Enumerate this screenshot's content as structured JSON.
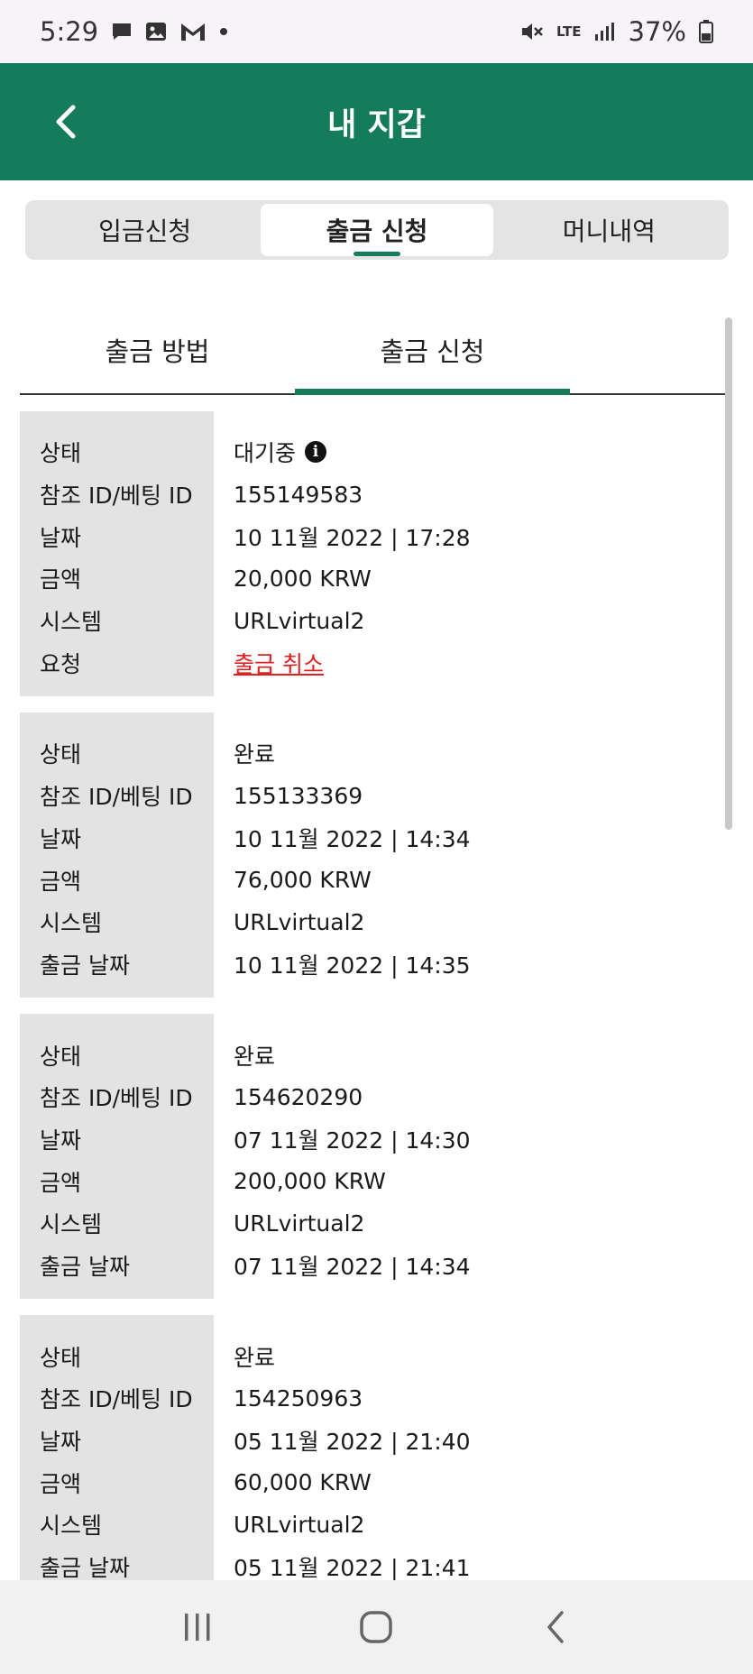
{
  "status_bar": {
    "time": "5:29",
    "battery": "37%",
    "network": "LTE"
  },
  "header": {
    "title": "내 지갑",
    "back_icon": "chevron-left-icon"
  },
  "segment_tabs": [
    {
      "label": "입금신청",
      "active": false
    },
    {
      "label": "출금 신청",
      "active": true
    },
    {
      "label": "머니내역",
      "active": false
    }
  ],
  "sub_tabs": [
    {
      "label": "출금 방법",
      "active": false
    },
    {
      "label": "출금 신청",
      "active": true
    }
  ],
  "records": [
    {
      "labels": [
        "상태",
        "참조 ID/베팅 ID",
        "날짜",
        "금액",
        "시스템",
        "요청"
      ],
      "status": "대기중",
      "ref_id": "155149583",
      "date": "10 11월 2022 | 17:28",
      "amount": "20,000 KRW",
      "system": "URLvirtual2",
      "extra": "출금 취소"
    },
    {
      "labels": [
        "상태",
        "참조 ID/베팅 ID",
        "날짜",
        "금액",
        "시스템",
        "출금 날짜"
      ],
      "status": "완료",
      "ref_id": "155133369",
      "date": "10 11월 2022 | 14:34",
      "amount": "76,000 KRW",
      "system": "URLvirtual2",
      "extra": "10 11월 2022 | 14:35"
    },
    {
      "labels": [
        "상태",
        "참조 ID/베팅 ID",
        "날짜",
        "금액",
        "시스템",
        "출금 날짜"
      ],
      "status": "완료",
      "ref_id": "154620290",
      "date": "07 11월 2022 | 14:30",
      "amount": "200,000 KRW",
      "system": "URLvirtual2",
      "extra": "07 11월 2022 | 14:34"
    },
    {
      "labels": [
        "상태",
        "참조 ID/베팅 ID",
        "날짜",
        "금액",
        "시스템",
        "출금 날짜"
      ],
      "status": "완료",
      "ref_id": "154250963",
      "date": "05 11월 2022 | 21:40",
      "amount": "60,000 KRW",
      "system": "URLvirtual2",
      "extra": "05 11월 2022 | 21:41"
    }
  ],
  "colors": {
    "brand_green": "#147c5a",
    "cancel_red": "#e02020",
    "label_bg": "#e3e3e3"
  }
}
